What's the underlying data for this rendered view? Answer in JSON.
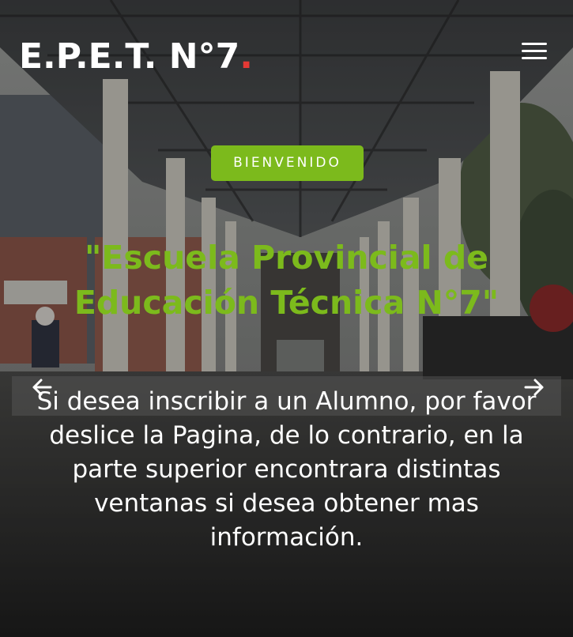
{
  "brand": {
    "name": "E.P.E.T. N°7",
    "accent_dot": ".",
    "accent_color": "#e53935"
  },
  "nav": {
    "menu_icon": "hamburger-menu-icon"
  },
  "hero": {
    "badge": "BIENVENIDO",
    "title_line1": "\"Escuela Provincial de",
    "title_line2": "Educación Técnica N°7\"",
    "description": "Si desea inscribir a un Alumno, por favor deslice la Pagina, de lo contrario, en la parte superior encontrara distintas ventanas si desea obtener mas información.",
    "accent_color": "#7cba1c",
    "prev_icon": "arrow-left-icon",
    "next_icon": "arrow-right-icon"
  }
}
